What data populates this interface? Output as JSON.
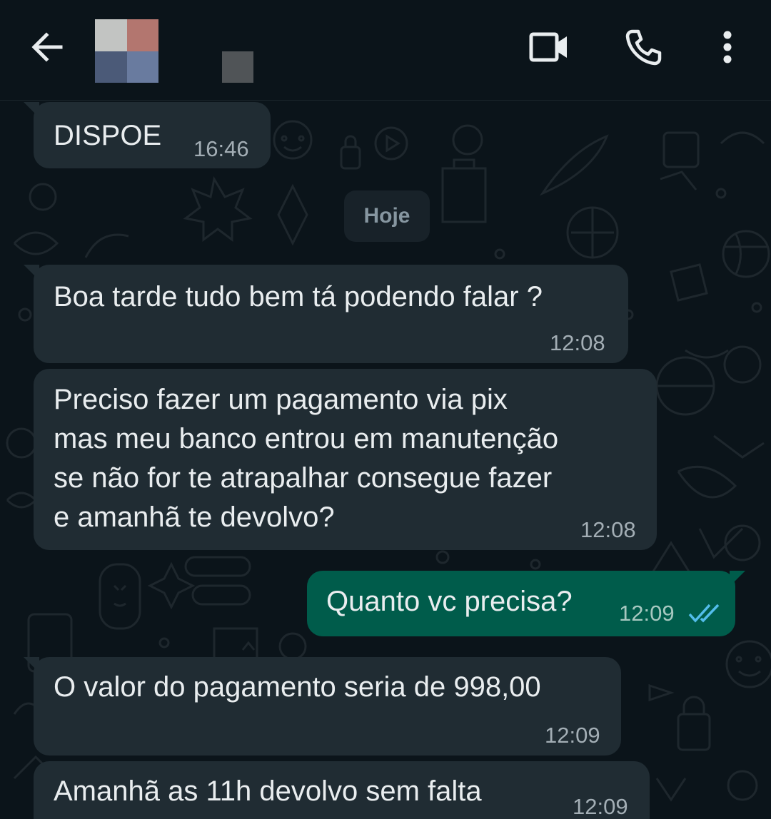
{
  "header": {
    "back_icon": "arrow-left-icon",
    "video_icon": "video-call-icon",
    "call_icon": "phone-icon",
    "menu_icon": "more-vertical-icon",
    "accent": "#e9edef"
  },
  "chat": {
    "date_separator": "Hoje",
    "messages": [
      {
        "direction": "incoming",
        "text": "DISPOE",
        "time": "16:46"
      },
      {
        "direction": "incoming",
        "text": "Boa tarde tudo bem tá podendo falar ?",
        "time": "12:08"
      },
      {
        "direction": "incoming",
        "lines": [
          "Preciso fazer um pagamento via pix",
          "mas meu banco entrou em manutenção",
          "se não for te atrapalhar consegue fazer",
          "e amanhã te devolvo?"
        ],
        "time": "12:08"
      },
      {
        "direction": "outgoing",
        "text": "Quanto vc precisa?",
        "time": "12:09",
        "status": "read",
        "status_icon": "double-check-icon",
        "status_color": "#53bdeb"
      },
      {
        "direction": "incoming",
        "text": "O valor do pagamento seria de 998,00",
        "time": "12:09"
      },
      {
        "direction": "incoming",
        "text": "Amanhã as 11h devolvo sem falta",
        "time": "12:09"
      }
    ]
  },
  "colors": {
    "background": "#0b141a",
    "incoming_bubble": "#202c33",
    "outgoing_bubble": "#005c4b"
  }
}
